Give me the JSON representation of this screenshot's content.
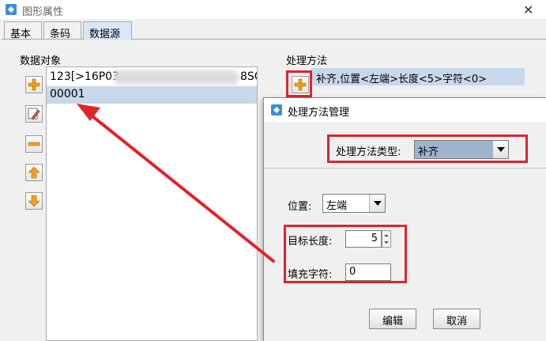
{
  "window": {
    "title": "图形属性",
    "close_glyph": "✕"
  },
  "tabs": [
    {
      "label": "基本"
    },
    {
      "label": "条码"
    },
    {
      "label": "数据源"
    }
  ],
  "data_objects": {
    "label": "数据对象",
    "items": [
      {
        "text": "123[>16P03",
        "trailing": "8SC"
      },
      {
        "text": "00001"
      }
    ]
  },
  "processing": {
    "label": "处理方法",
    "item": "补齐,位置<左端>长度<5>字符<0>"
  },
  "dialog": {
    "title": "处理方法管理",
    "type_label": "处理方法类型:",
    "type_value": "补齐",
    "position_label": "位置:",
    "position_value": "左端",
    "length_label": "目标长度:",
    "length_value": "5",
    "fill_label": "填充字符:",
    "fill_value": "0",
    "edit_button": "编辑",
    "cancel_button": "取消"
  },
  "colors": {
    "selection": "#c8d8eb",
    "highlight_red": "#e0242a",
    "active_tab": "#d9e8f8"
  }
}
